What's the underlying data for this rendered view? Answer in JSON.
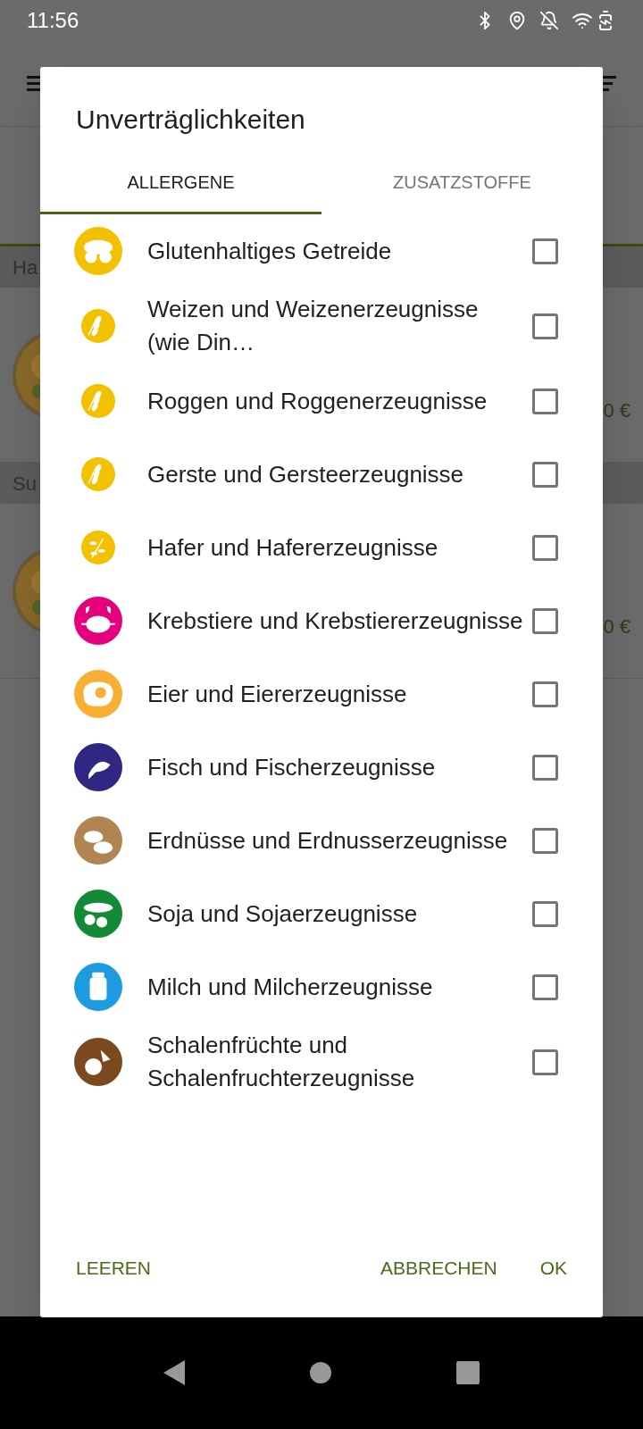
{
  "status_bar": {
    "time": "11:56"
  },
  "background": {
    "sections": [
      {
        "header": "Ha",
        "price": "0 €"
      },
      {
        "header": "Su",
        "price": "0 €"
      }
    ]
  },
  "dialog": {
    "title": "Unverträglichkeiten",
    "tabs": [
      {
        "label": "ALLERGENE",
        "selected": true
      },
      {
        "label": "ZUSATZSTOFFE",
        "selected": false
      }
    ],
    "items": [
      {
        "label": "Glutenhaltiges Getreide",
        "checked": false,
        "color": "#f2c200"
      },
      {
        "label": "Weizen und Weizenerzeugnisse (wie Din…",
        "checked": false,
        "color": "#f2c200"
      },
      {
        "label": "Roggen und Roggenerzeugnisse",
        "checked": false,
        "color": "#f2c200"
      },
      {
        "label": "Gerste und Gersteerzeugnisse",
        "checked": false,
        "color": "#f2c200"
      },
      {
        "label": "Hafer und Hafererzeugnisse",
        "checked": false,
        "color": "#f2c200"
      },
      {
        "label": "Krebstiere und Krebstiererzeugnisse",
        "checked": false,
        "color": "#e5007e"
      },
      {
        "label": "Eier und Eiererzeugnisse",
        "checked": false,
        "color": "#f7b033"
      },
      {
        "label": "Fisch und Fischerzeugnisse",
        "checked": false,
        "color": "#312783"
      },
      {
        "label": "Erdnüsse und Erdnusserzeugnisse",
        "checked": false,
        "color": "#b08552"
      },
      {
        "label": "Soja und Sojaerzeugnisse",
        "checked": false,
        "color": "#138a36"
      },
      {
        "label": "Milch und Milcherzeugnisse",
        "checked": false,
        "color": "#1d9be0"
      },
      {
        "label": "Schalenfrüchte und Schalenfruchterzeugnisse",
        "checked": false,
        "color": "#7a4a1e"
      }
    ],
    "buttons": [
      "LEEREN",
      "ABBRECHEN",
      "OK"
    ]
  }
}
